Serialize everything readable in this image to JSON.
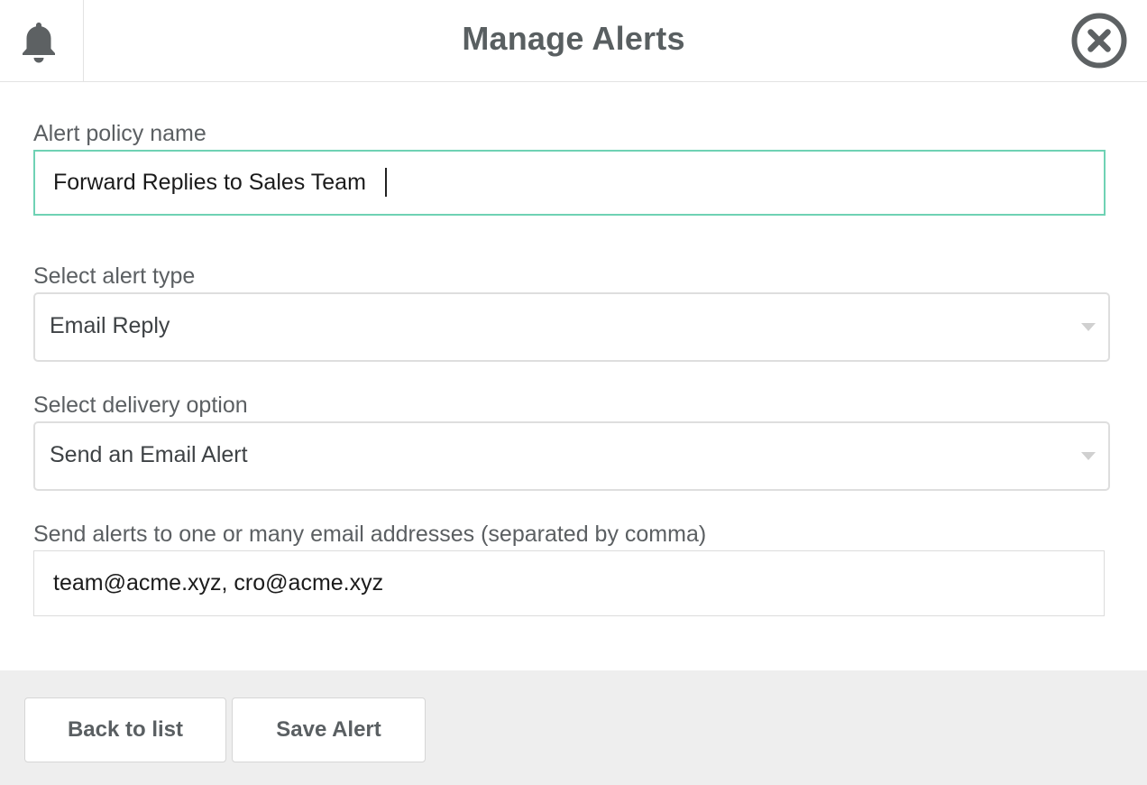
{
  "header": {
    "title": "Manage Alerts",
    "bell_icon": "bell-icon",
    "close_icon": "close-circle-icon"
  },
  "form": {
    "policy_name": {
      "label": "Alert policy name",
      "value": "Forward Replies to Sales Team"
    },
    "alert_type": {
      "label": "Select alert type",
      "selected": "Email Reply"
    },
    "delivery_option": {
      "label": "Select delivery option",
      "selected": "Send an Email Alert"
    },
    "email_addresses": {
      "label": "Send alerts to one or many email addresses (separated by comma)",
      "value": "team@acme.xyz, cro@acme.xyz"
    }
  },
  "footer": {
    "back_label": "Back to list",
    "save_label": "Save Alert"
  },
  "colors": {
    "focus_border": "#6fd2b4",
    "footer_bg": "#eeeeee",
    "icon_gray": "#5d6163"
  }
}
